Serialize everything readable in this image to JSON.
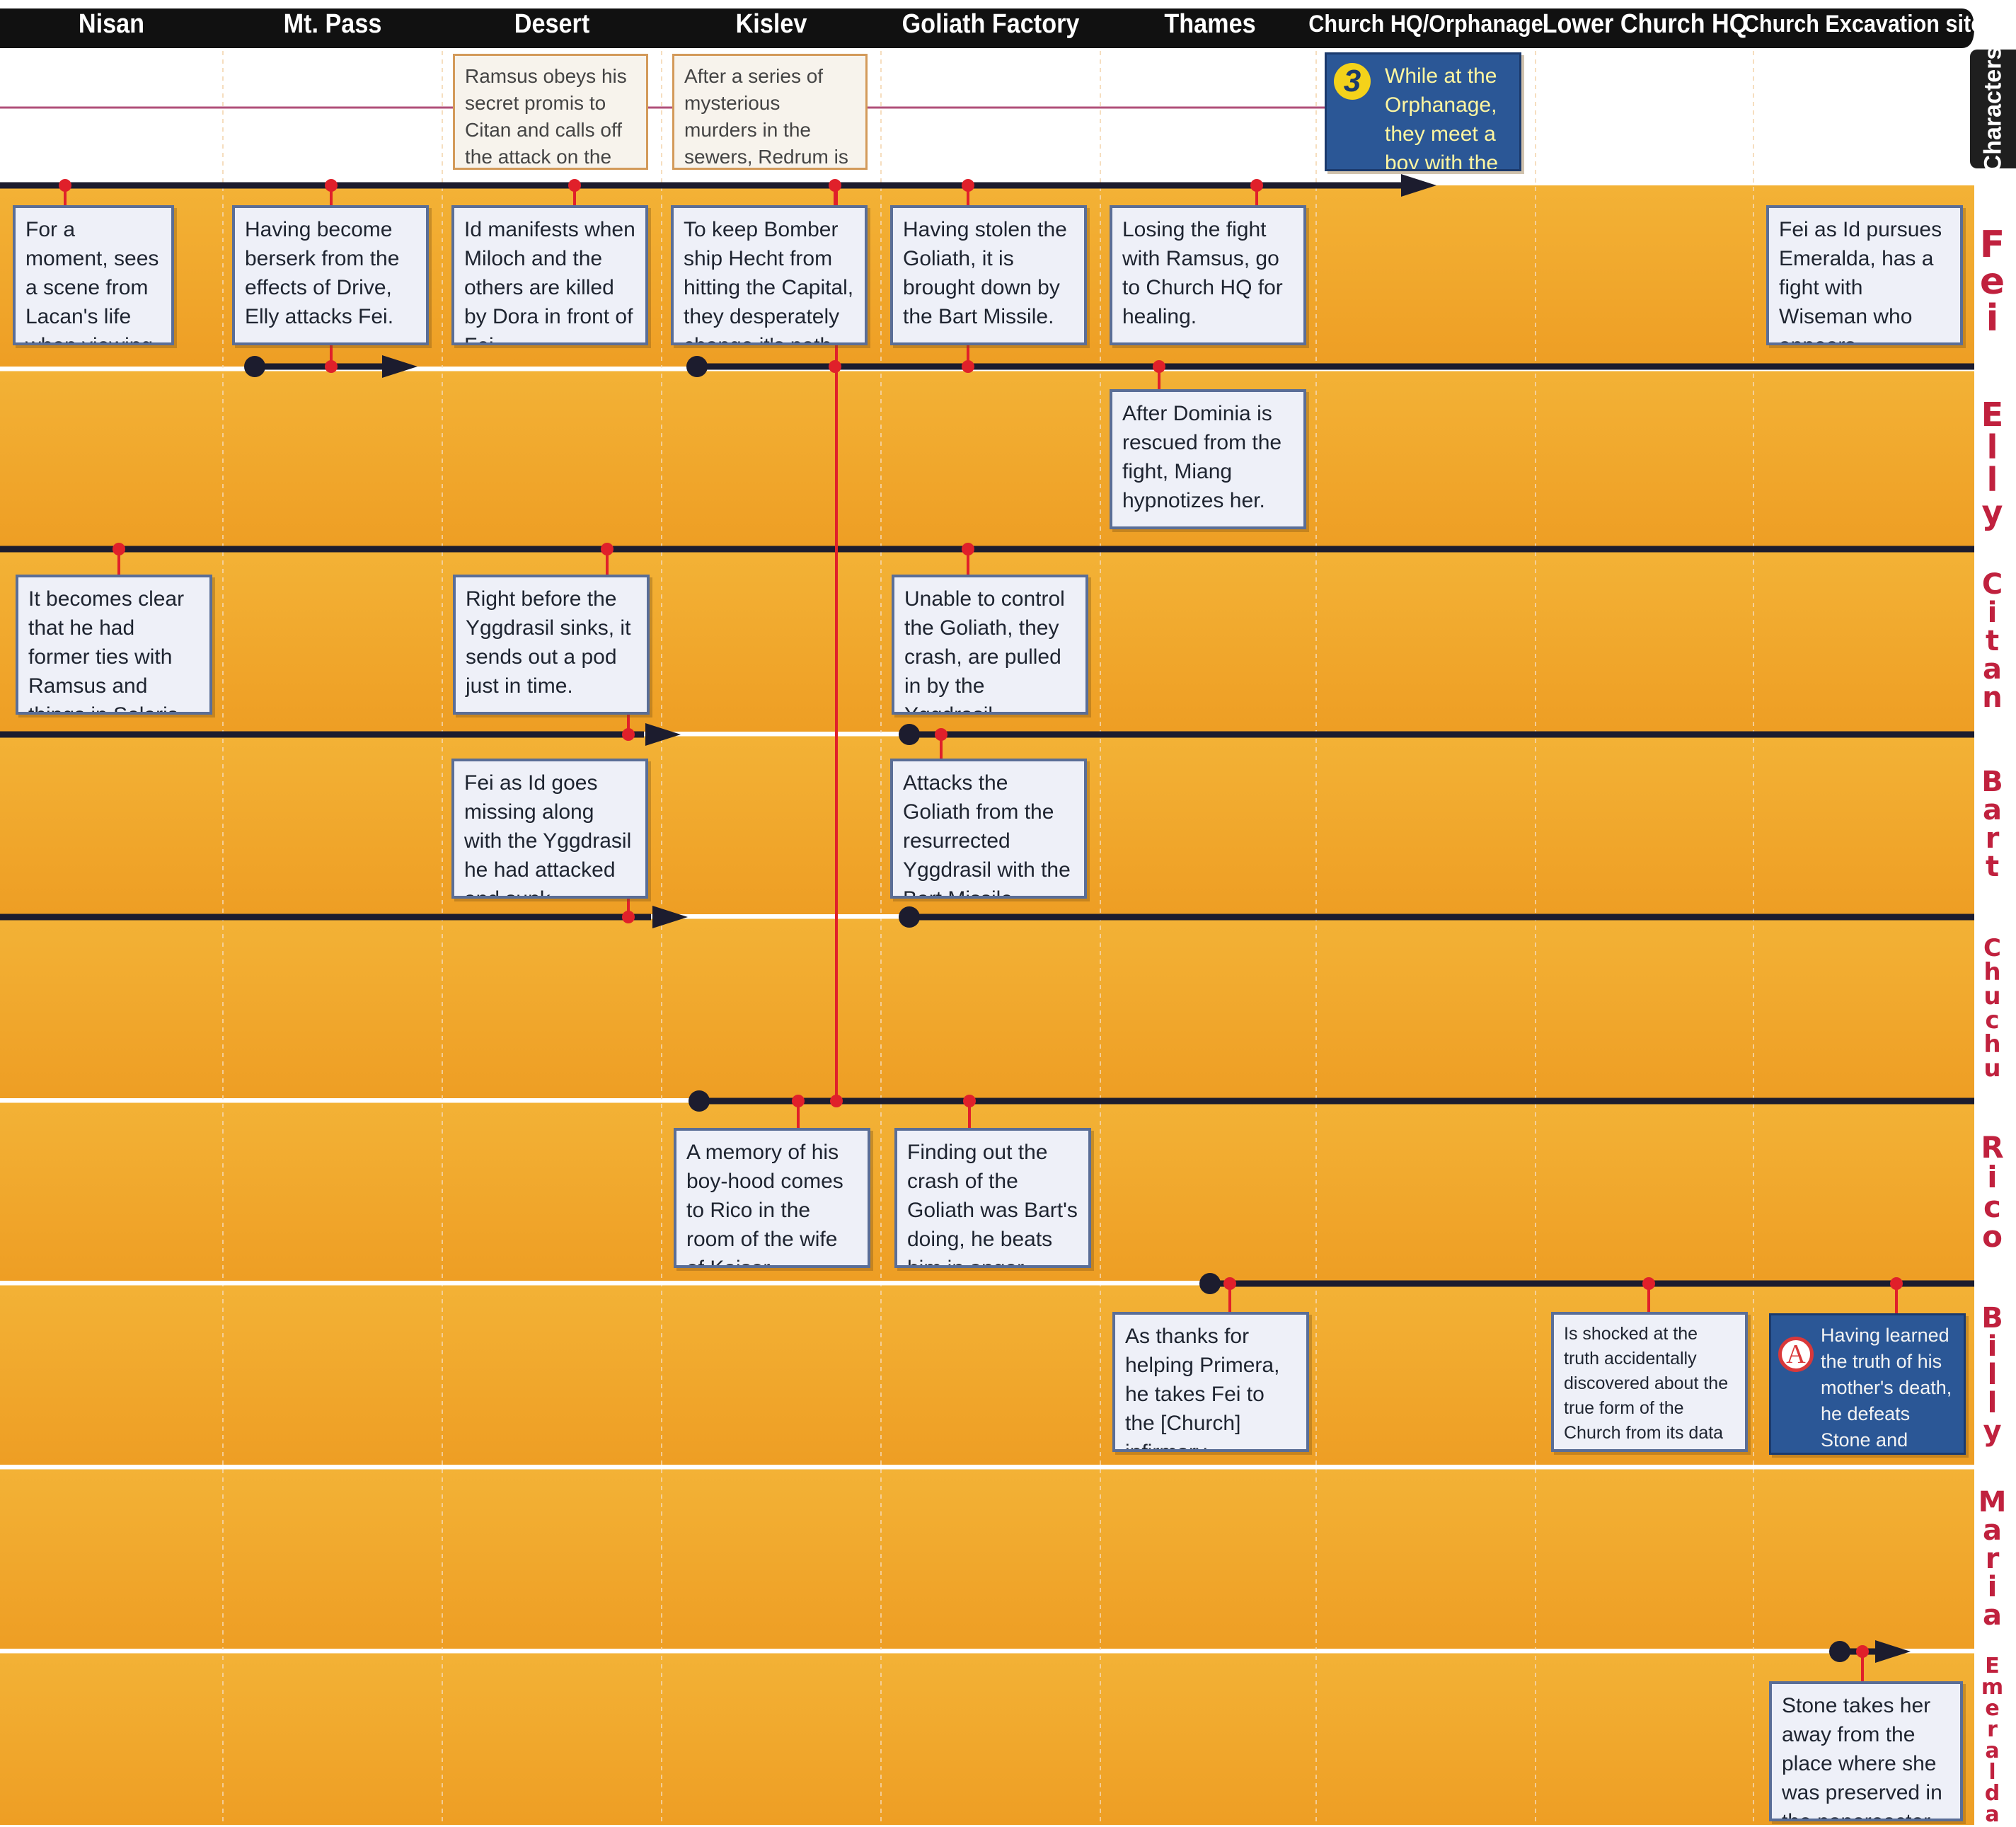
{
  "locations": [
    "Nisan",
    "Mt. Pass",
    "Desert",
    "Kislev",
    "Goliath Factory",
    "Thames",
    "Church HQ/Orphanage",
    "Lower Church HQ",
    "Church Excavation site"
  ],
  "characters_label": "Characters",
  "characters": [
    "Fei",
    "Elly",
    "Citan",
    "Bart",
    "Chuchu",
    "Rico",
    "Billy",
    "Maria",
    "Emeralda"
  ],
  "top_events": {
    "desert": "Ramsus obeys his secret promis to Citan and calls off the attack on the Yggdrasil.",
    "kislev": "After a series of mysterious murders in the sewers, Redrum is defeated.",
    "church_hq": "While at the Orphanage, they meet a boy with the same bell as Redrum.",
    "church_hq_badge": "3"
  },
  "events": {
    "fei_nisan": "For a moment, sees a scene from Lacan's life when viewing Sophia's portrait.",
    "fei_mtpass": "Having become berserk from the effects of Drive, Elly attacks Fei.",
    "fei_desert": "Id manifests when Miloch and the others are killed by Dora in front of Fei.",
    "fei_kislev": "To keep Bomber ship Hecht from hitting the Capital, they desperately change it's path.",
    "fei_goliath": "Having stolen the Goliath, it is brought down by the Bart Missile.",
    "fei_thames": "Losing the fight with Ramsus, go to Church HQ for healing.",
    "fei_excavation": "Fei as Id pursues Emeralda, has a fight with Wiseman who appears.",
    "elly_thames": "After Dominia is rescued from the fight, Miang hypnotizes her.",
    "citan_nisan": "It becomes clear that he had former ties with Ramsus and things in Solaris.",
    "citan_desert": "Right before the Yggdrasil sinks, it sends out a pod just in time.",
    "citan_goliath": "Unable to control the Goliath, they crash, are pulled in by the Yggdrasil.",
    "bart_desert": "Fei as Id goes missing along with the Yggdrasil he had attacked and sunk.",
    "bart_goliath": "Attacks the Goliath from the resurrected Yggdrasil with the Bart Missile.",
    "rico_kislev": "A memory of his boy-hood comes to Rico in the room of the wife of Kaiser Sigmund.",
    "rico_goliath": "Finding out the crash of the Goliath was Bart's doing, he beats him in anger.",
    "billy_thames": "As thanks for helping Primera, he takes Fei to the [Church] infirmary.",
    "billy_lower": "Is shocked at the truth accidentally discovered about the true form of the Church from its data banks.",
    "billy_excavation": "Having learned the truth of his mother's death, he defeats Stone and purges his hatred.",
    "billy_excavation_badge": "A",
    "emeralda_excavation": "Stone takes her away from the place where she was preserved in the nanoreactor."
  },
  "colors": {
    "band": "#f0a82c",
    "header": "#111111",
    "timeline": "#1c1c2e",
    "marker": "#e0202a",
    "character_text": "#c0213e",
    "box_border": "#5a6e97",
    "highlight_box": "#2b5796"
  }
}
